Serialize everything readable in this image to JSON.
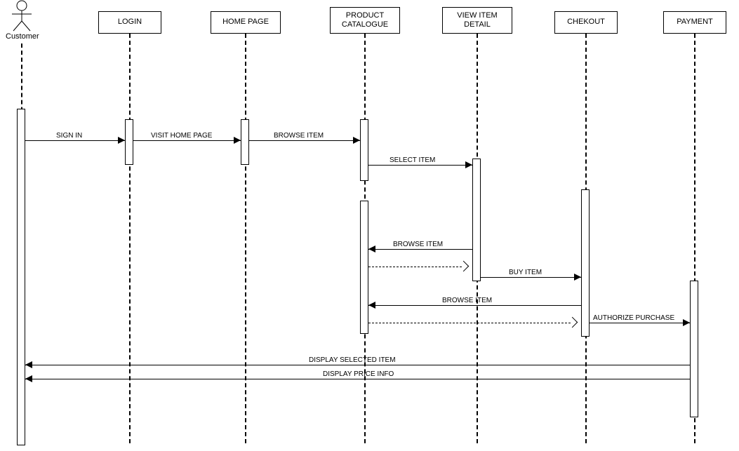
{
  "actor": {
    "label": "Customer"
  },
  "lifelines": {
    "login": "LOGIN",
    "home": "HOME PAGE",
    "catalog": "PRODUCT CATALOGUE",
    "view": "VIEW ITEM DETAIL",
    "checkout": "CHEKOUT",
    "payment": "PAYMENT"
  },
  "messages": {
    "signin": "SIGN IN",
    "visitHome": "VISIT HOME PAGE",
    "browse1": "BROWSE ITEM",
    "selectItem": "SELECT ITEM",
    "browse2": "BROWSE ITEM",
    "buyItem": "BUY ITEM",
    "browse3": "BROWSE ITEM",
    "authorize": "AUTHORIZE PURCHASE",
    "displaySelected": "DISPLAY SELECTED ITEM",
    "displayPrice": "DISPLAY PRICE INFO"
  }
}
